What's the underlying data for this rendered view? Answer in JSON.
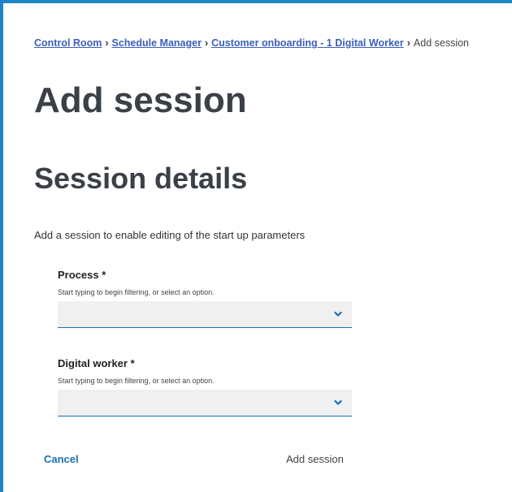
{
  "breadcrumb": {
    "items": [
      "Control Room",
      "Schedule Manager",
      "Customer onboarding - 1 Digital Worker"
    ],
    "current": "Add session",
    "separator": "›"
  },
  "page": {
    "title": "Add session",
    "section_title": "Session details",
    "intro": "Add a session to enable editing of the start up parameters"
  },
  "fields": {
    "process": {
      "label": "Process *",
      "help": "Start typing to begin filtering, or select an option.",
      "value": ""
    },
    "digital_worker": {
      "label": "Digital worker *",
      "help": "Start typing to begin filtering, or select an option.",
      "value": ""
    }
  },
  "actions": {
    "cancel": "Cancel",
    "add": "Add session"
  },
  "colors": {
    "accent": "#1a84c7",
    "link": "#3b5fb8",
    "field_bg": "#f0f0f0"
  }
}
